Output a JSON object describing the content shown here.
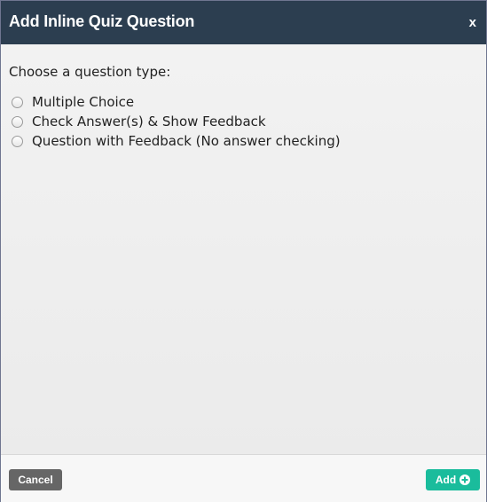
{
  "dialog": {
    "title": "Add Inline Quiz Question",
    "close_label": "x",
    "prompt": "Choose a question type:",
    "options": [
      {
        "label": "Multiple Choice",
        "selected": false
      },
      {
        "label": "Check Answer(s) & Show Feedback",
        "selected": false
      },
      {
        "label": "Question with Feedback (No answer checking)",
        "selected": false
      }
    ],
    "footer": {
      "cancel_label": "Cancel",
      "add_label": "Add",
      "add_icon": "plus-circle-icon"
    }
  },
  "colors": {
    "titlebar": "#2c3e50",
    "add_button": "#1abc9c",
    "cancel_button": "#666666",
    "body": "#eeeeee"
  }
}
